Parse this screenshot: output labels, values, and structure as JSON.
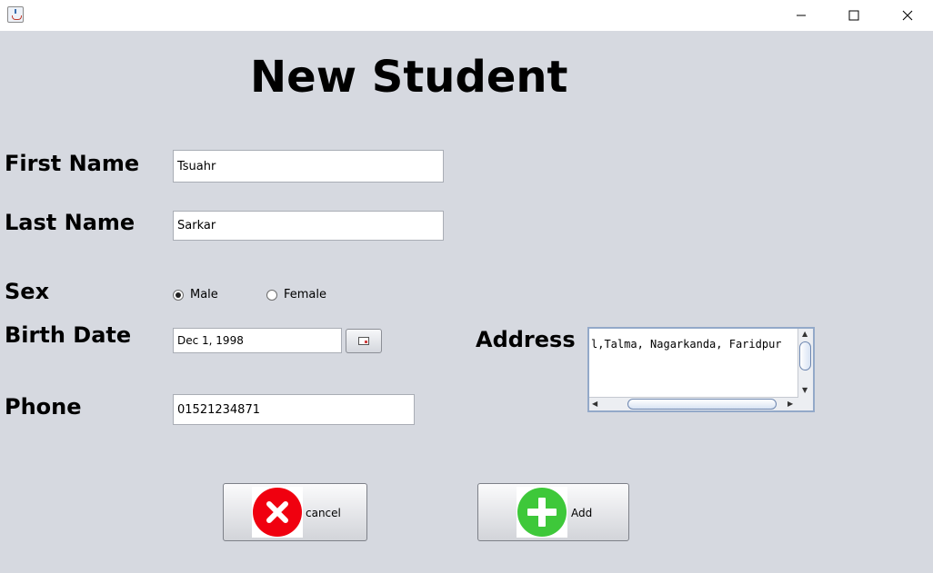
{
  "window": {
    "minimize_icon": "minimize-icon",
    "maximize_icon": "maximize-icon",
    "close_icon": "close-icon"
  },
  "form": {
    "heading": "New Student",
    "first_name": {
      "label": "First Name",
      "value": "Tsuahr"
    },
    "last_name": {
      "label": "Last Name",
      "value": "Sarkar"
    },
    "sex": {
      "label": "Sex",
      "options": [
        "Male",
        "Female"
      ],
      "selected": "Male"
    },
    "birth_date": {
      "label": "Birth Date",
      "value": "Dec 1, 1998"
    },
    "phone": {
      "label": "Phone",
      "value": "01521234871"
    },
    "address": {
      "label": "Address",
      "value": "l,Talma, Nagarkanda, Faridpur"
    }
  },
  "buttons": {
    "cancel": {
      "label": "cancel",
      "icon": "cancel-icon",
      "color": "#f0000f"
    },
    "add": {
      "label": "Add",
      "icon": "add-icon",
      "color": "#3ec83a"
    }
  }
}
